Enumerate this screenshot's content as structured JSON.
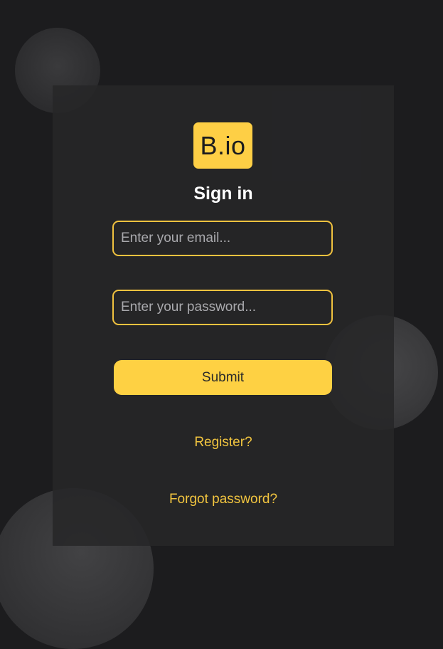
{
  "brand": {
    "logo_text": "B.io",
    "accent_color": "#fecf45"
  },
  "form": {
    "title": "Sign in",
    "email": {
      "placeholder": "Enter your email...",
      "value": ""
    },
    "password": {
      "placeholder": "Enter your password...",
      "value": ""
    },
    "submit_label": "Submit"
  },
  "links": {
    "register": "Register?",
    "forgot_password": "Forgot password?"
  },
  "colors": {
    "background": "#1c1c1e",
    "card": "#262628",
    "accent": "#fecf45",
    "text": "#ffffff"
  }
}
